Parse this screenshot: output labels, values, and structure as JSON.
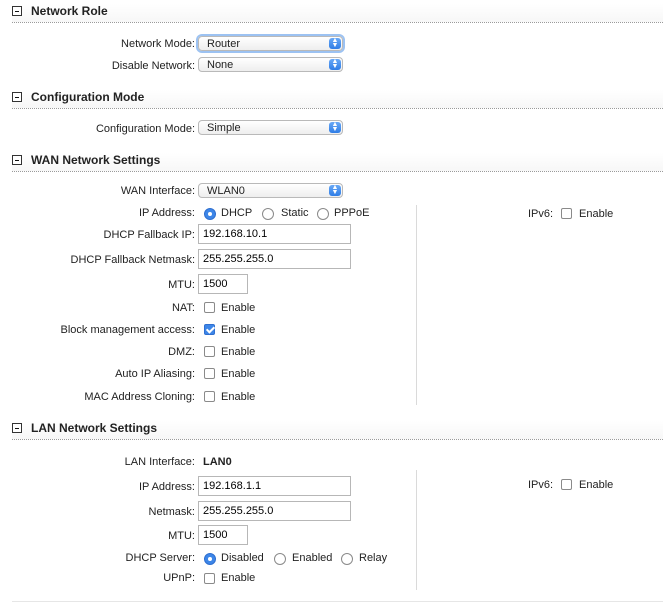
{
  "network_role": {
    "title": "Network Role",
    "network_mode_label": "Network Mode:",
    "network_mode_value": "Router",
    "disable_network_label": "Disable Network:",
    "disable_network_value": "None"
  },
  "configuration_mode": {
    "title": "Configuration Mode",
    "label": "Configuration Mode:",
    "value": "Simple"
  },
  "wan": {
    "title": "WAN Network Settings",
    "interface_label": "WAN Interface:",
    "interface_value": "WLAN0",
    "ip_address_label": "IP Address:",
    "ip_options": [
      "DHCP",
      "Static",
      "PPPoE"
    ],
    "ip_selected": "DHCP",
    "fallback_ip_label": "DHCP Fallback IP:",
    "fallback_ip_value": "192.168.10.1",
    "fallback_netmask_label": "DHCP Fallback Netmask:",
    "fallback_netmask_value": "255.255.255.0",
    "mtu_label": "MTU:",
    "mtu_value": "1500",
    "nat_label": "NAT:",
    "block_mgmt_label": "Block management access:",
    "dmz_label": "DMZ:",
    "auto_ip_label": "Auto IP Aliasing:",
    "mac_clone_label": "MAC Address Cloning:",
    "enable_text": "Enable",
    "ipv6_label": "IPv6:",
    "checks": {
      "nat": false,
      "block_mgmt": true,
      "dmz": false,
      "auto_ip": false,
      "mac_clone": false,
      "ipv6": false
    }
  },
  "lan": {
    "title": "LAN Network Settings",
    "interface_label": "LAN Interface:",
    "interface_value": "LAN0",
    "ip_address_label": "IP Address:",
    "ip_address_value": "192.168.1.1",
    "netmask_label": "Netmask:",
    "netmask_value": "255.255.255.0",
    "mtu_label": "MTU:",
    "mtu_value": "1500",
    "dhcp_server_label": "DHCP Server:",
    "dhcp_options": [
      "Disabled",
      "Enabled",
      "Relay"
    ],
    "dhcp_selected": "Disabled",
    "upnp_label": "UPnP:",
    "enable_text": "Enable",
    "ipv6_label": "IPv6:",
    "checks": {
      "upnp": false,
      "ipv6": false
    }
  },
  "colors": {
    "accent": "#3d86e8"
  }
}
